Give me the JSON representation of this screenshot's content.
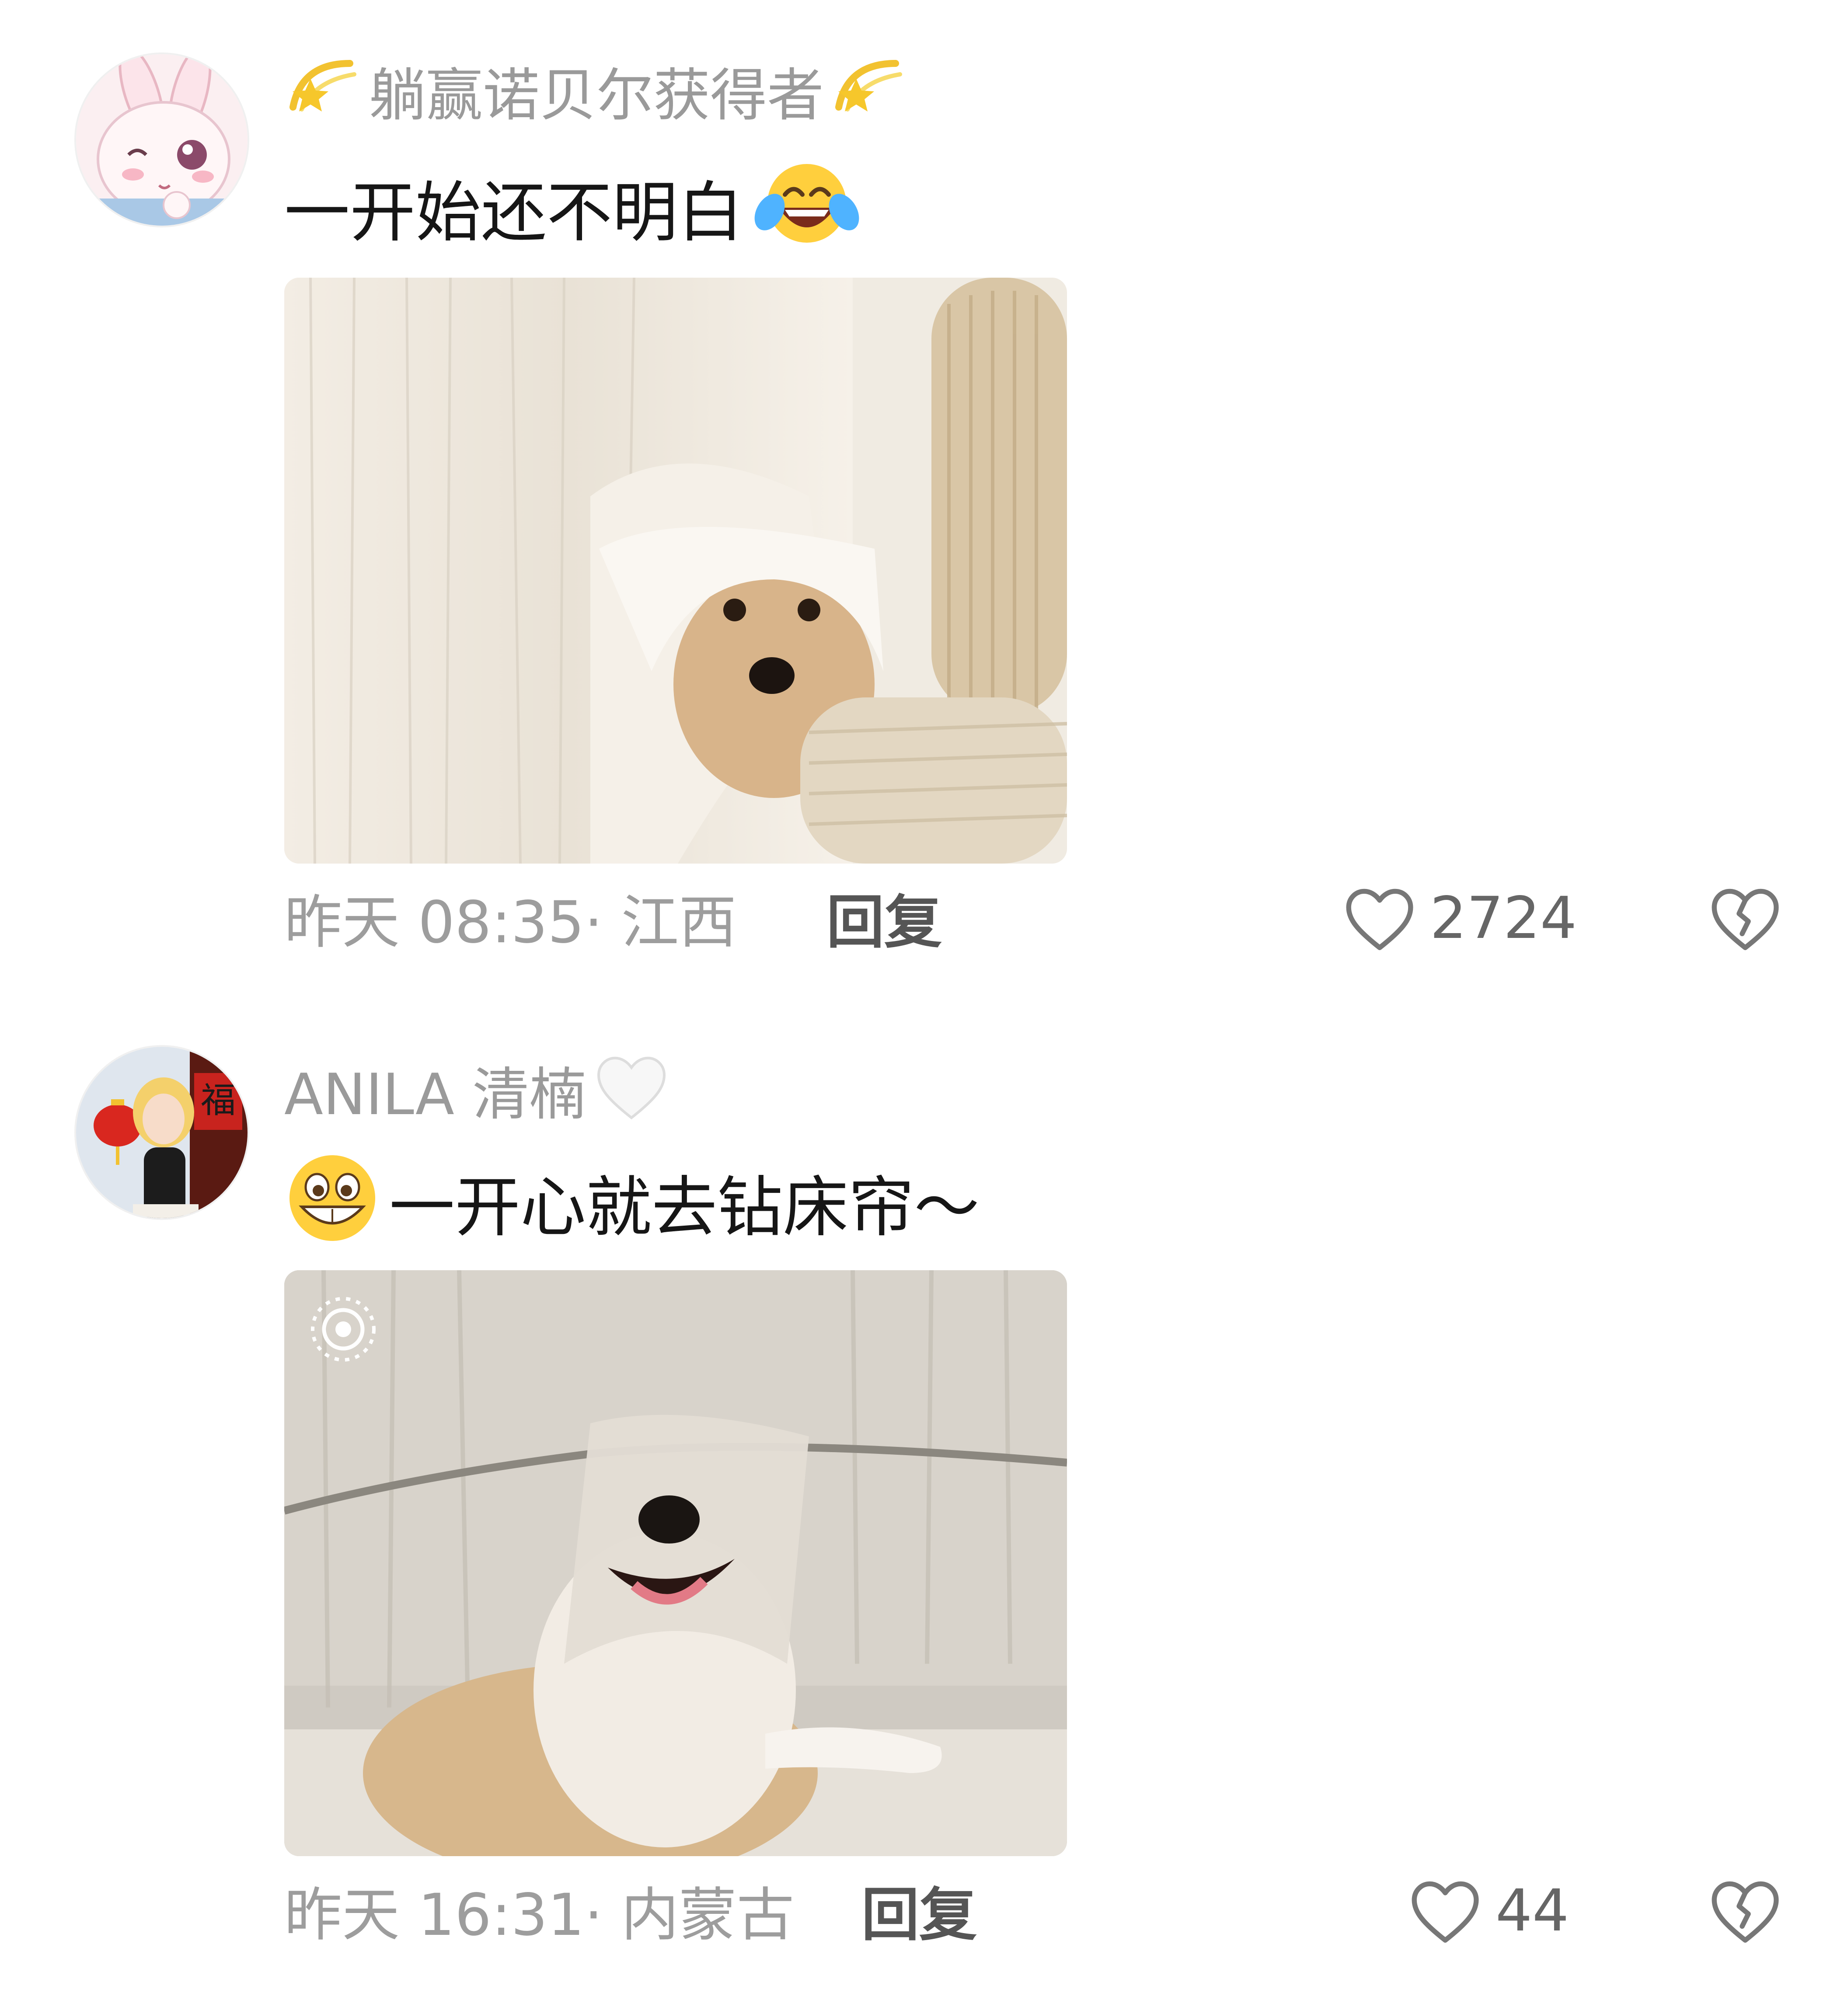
{
  "comments": [
    {
      "username": "躺赢诺贝尔获得者",
      "username_emoji": "dizzy-emoji",
      "text": "一开始还不明白",
      "text_emoji": "tears-of-joy-emoji",
      "image": "dog peeking from under white curtain next to knit cushion",
      "time": "昨天 08:35",
      "location": "· 江西",
      "reply_label": "回复",
      "likes": "2724"
    },
    {
      "username": "ANILA 清楠",
      "username_emoji": "white-heart-emoji",
      "text": "一开心就去钻床帘～",
      "text_emoji": "grinning-face-emoji",
      "image": "smiling dog lying under sheer curtain covering its eyes",
      "time": "昨天 16:31",
      "location": "· 内蒙古",
      "reply_label": "回复",
      "likes": "44"
    }
  ],
  "icons": {
    "like": "heart-outline-icon",
    "dislike": "broken-heart-icon",
    "live_photo": "live-photo-icon"
  },
  "colors": {
    "username": "#9a9a9a",
    "text": "#161616",
    "meta": "#9d9d9d",
    "reply": "#555555"
  }
}
